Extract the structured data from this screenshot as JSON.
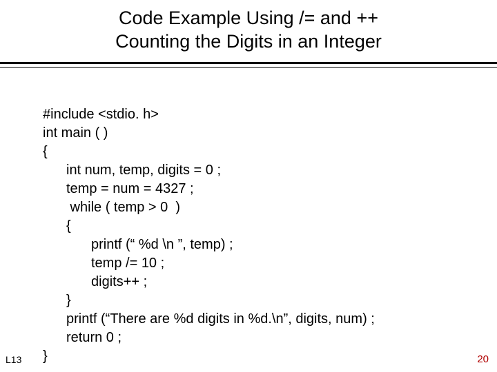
{
  "title_line1": "Code Example Using  /= and ++",
  "title_line2": "Counting the Digits in an Integer",
  "code": {
    "l0": "#include <stdio. h>",
    "l1": "int main ( )",
    "l2": "{",
    "l3": "int num, temp, digits = 0 ;",
    "l4": "temp = num = 4327 ;",
    "l5": " while ( temp > 0  )",
    "l6": "{",
    "l7": "printf (“ %d \\n ”, temp) ;",
    "l8": "temp /= 10 ;",
    "l9": "digits++ ;",
    "l10": "}",
    "l11": "printf (“There are %d digits in %d.\\n”, digits, num) ;",
    "l12": "return 0 ;",
    "l13": "}"
  },
  "footer_left": "L13",
  "footer_right": "20"
}
